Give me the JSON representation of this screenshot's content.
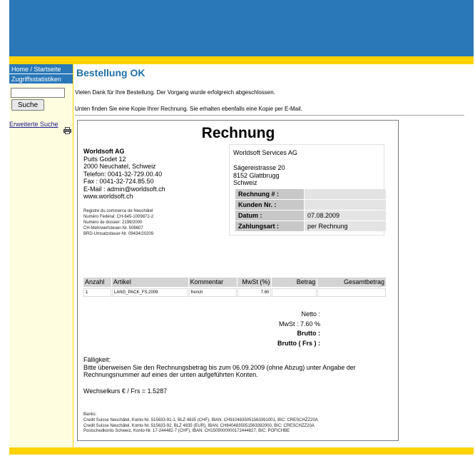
{
  "nav": {
    "home": "Home / Startseite",
    "stats": "Zugriffsstatistiken",
    "search_value": "",
    "search_button": "Suche",
    "advanced_search": "Erweiterte Suche"
  },
  "page": {
    "title": "Bestellung OK",
    "message1": "Vielen Dank für Ihre Bestellung. Der Vorgang wurde erfolgreich abgeschlossen.",
    "message2": "Unten finden Sie eine Kopie Ihrer Rechnung. Sie erhalten ebenfalls eine Kopie per E-Mail."
  },
  "invoice": {
    "title": "Rechnung",
    "sender": {
      "name": "Worldsoft AG",
      "street": "Puits Godet 12",
      "city": "2000 Neuchatel, Schweiz",
      "phone": "Telefon: 0041-32-729.00.40",
      "fax": "Fax : 0041-32-724.85.50",
      "email": "E-Mail : admin@worldsoft.ch",
      "web": "www.worldsoft.ch"
    },
    "legal": [
      "Registre du commerce de Neuchâtel",
      "Numéro Fédéral: CH-645-1009872-2",
      "Numéro de dossier: 2199/2000",
      "CH-Mehrwertsteuer-Nr. 508607",
      "BRD-Umsatzsteuer-Nr. 09434/20209"
    ],
    "recipient": {
      "name": "Worldsoft Services AG",
      "street": "Sägereistrasse 20",
      "city": "8152 Glattbrugg",
      "country": "Schweiz"
    },
    "meta": {
      "invoice_no_label": "Rechnung # :",
      "invoice_no_value": "",
      "customer_no_label": "Kunden Nr. :",
      "customer_no_value": "",
      "date_label": "Datum :",
      "date_value": "07.08.2009",
      "payment_label": "Zahlungsart :",
      "payment_value": "per Rechnung"
    },
    "columns": [
      "Anzahl",
      "Artikel",
      "Kommentar",
      "MwSt (%)",
      "Betrag",
      "Gesamtbetrag"
    ],
    "items": [
      {
        "qty": "1",
        "article": "LANG_PACK_FS.2009",
        "comment": "french",
        "vat": "7.60",
        "amount": "",
        "total": ""
      }
    ],
    "totals": {
      "net": "Netto :",
      "vat": "MwSt : 7.60 %",
      "gross": "Brutto :",
      "gross_frs": "Brutto ( Frs ) :"
    },
    "due_label": "Fälligkeit:",
    "due_text": "Bitte überweisen Sie den Rechnungsbetrag bis zum 06.09.2009 (ohne Abzug) unter Angabe der Rechnungsnummer auf eines der unten aufgeführten Konten.",
    "exchange_rate": "Wechselkurs € / Frs = 1.5287",
    "banks_label": "Banks:",
    "banks": [
      "Credit Suisse Neuchâtel, Konto-Nr. 515633-91-1, BLZ 4835 (CHF), IBAN: CH9104835051563391001, BIC: CRESCHZZ20A",
      "Credit Suisse Neuchâtel, Konto-Nr. 515633-92, BLZ 4835 (EUR), IBAN: CH8404835051563392000, BIC: CRESCHZZ20A",
      "Postschedkonto Schweiz, Konto-Nr. 17-244482-7 (CHF), IBAN: CH1509000000172444827, BIC: POFICHBE"
    ]
  },
  "colors": {
    "brand_blue": "#2a78b8",
    "brand_yellow": "#ffd200",
    "title_blue": "#1f6fa6"
  }
}
